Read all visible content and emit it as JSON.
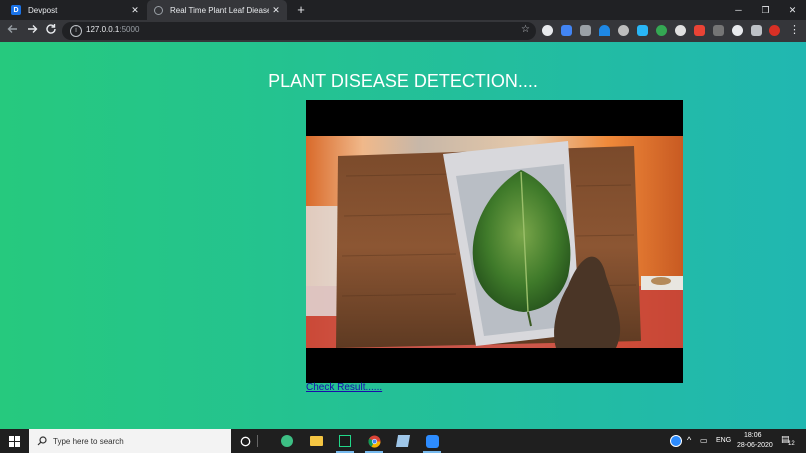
{
  "browser": {
    "tabs": [
      {
        "label": "Devpost",
        "favicon_letter": "D"
      },
      {
        "label": "Real Time Plant Leaf Diease Detec"
      }
    ],
    "address": {
      "host": "127.0.0.1",
      "port": ":5000"
    },
    "icons": {
      "back": "arrow-left-icon",
      "forward": "arrow-right-icon",
      "reload": "reload-icon",
      "bookmark": "star-icon",
      "menu": "kebab-menu-icon"
    }
  },
  "page": {
    "title": "PLANT DISEASE DETECTION....",
    "check_link": "Check Result......",
    "colors": {
      "gradient_start": "#26c97e",
      "gradient_end": "#21b7b1"
    }
  },
  "taskbar": {
    "search_placeholder": "Type here to search",
    "language": "ENG",
    "time": "18:06",
    "date": "28-06-2020",
    "notifications": "12"
  }
}
